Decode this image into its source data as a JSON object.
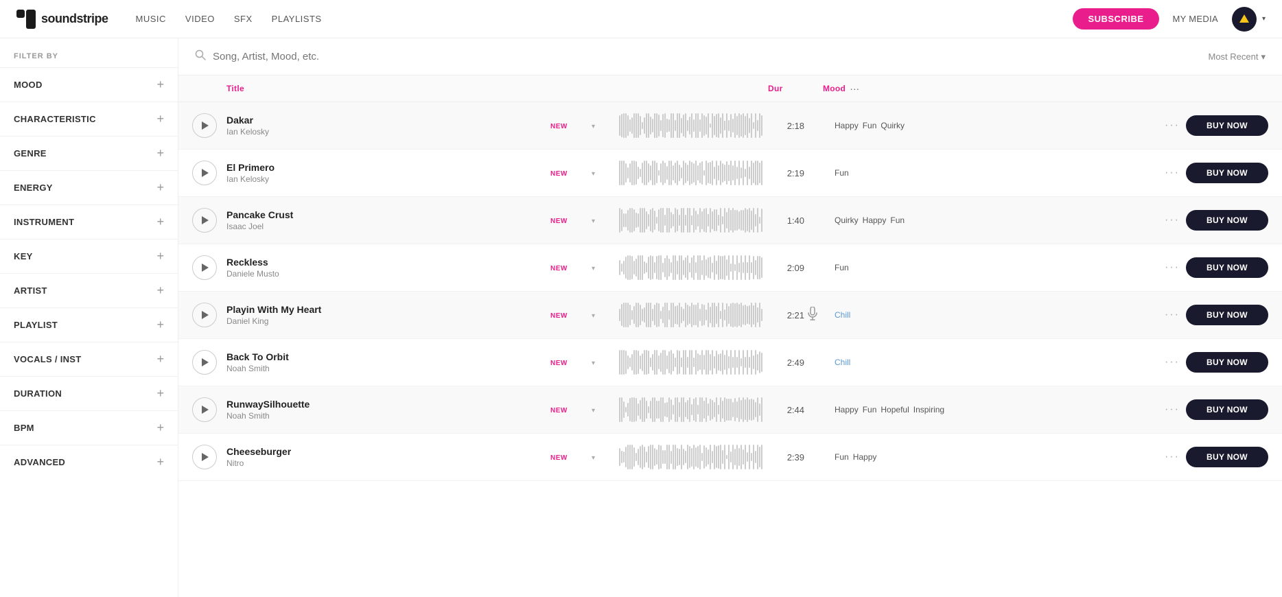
{
  "header": {
    "logo_text": "soundstripe",
    "nav": [
      {
        "label": "MUSIC",
        "id": "music"
      },
      {
        "label": "VIDEO",
        "id": "video"
      },
      {
        "label": "SFX",
        "id": "sfx"
      },
      {
        "label": "PLAYLISTS",
        "id": "playlists"
      }
    ],
    "subscribe_label": "SUBSCRIBE",
    "my_media_label": "MY MEDIA",
    "sort_label": "Most Recent",
    "sort_chevron": "▾"
  },
  "sidebar": {
    "filter_by_label": "FILTER BY",
    "filters": [
      {
        "label": "MOOD",
        "id": "mood"
      },
      {
        "label": "CHARACTERISTIC",
        "id": "characteristic"
      },
      {
        "label": "GENRE",
        "id": "genre"
      },
      {
        "label": "ENERGY",
        "id": "energy"
      },
      {
        "label": "INSTRUMENT",
        "id": "instrument"
      },
      {
        "label": "KEY",
        "id": "key"
      },
      {
        "label": "ARTIST",
        "id": "artist"
      },
      {
        "label": "PLAYLIST",
        "id": "playlist"
      },
      {
        "label": "VOCALS / INST",
        "id": "vocals"
      },
      {
        "label": "DURATION",
        "id": "duration"
      },
      {
        "label": "BPM",
        "id": "bpm"
      },
      {
        "label": "ADVANCED",
        "id": "advanced"
      }
    ]
  },
  "search": {
    "placeholder": "Song, Artist, Mood, etc."
  },
  "table": {
    "col_title": "Title",
    "col_dur": "Dur",
    "col_mood": "Mood",
    "mood_dots": "···"
  },
  "tracks": [
    {
      "title": "Dakar",
      "artist": "Ian Kelosky",
      "is_new": "NEW",
      "duration": "2:18",
      "moods": [
        "Happy",
        "Fun",
        "Quirky"
      ],
      "has_mic": false,
      "mood_colors": [
        "default",
        "default",
        "default"
      ]
    },
    {
      "title": "El Primero",
      "artist": "Ian Kelosky",
      "is_new": "NEW",
      "duration": "2:19",
      "moods": [
        "Fun"
      ],
      "has_mic": false,
      "mood_colors": [
        "default"
      ]
    },
    {
      "title": "Pancake Crust",
      "artist": "Isaac Joel",
      "is_new": "NEW",
      "duration": "1:40",
      "moods": [
        "Quirky",
        "Happy",
        "Fun"
      ],
      "has_mic": false,
      "mood_colors": [
        "default",
        "default",
        "default"
      ]
    },
    {
      "title": "Reckless",
      "artist": "Daniele Musto",
      "is_new": "NEW",
      "duration": "2:09",
      "moods": [
        "Fun"
      ],
      "has_mic": false,
      "mood_colors": [
        "default"
      ]
    },
    {
      "title": "Playin With My Heart",
      "artist": "Daniel King",
      "is_new": "NEW",
      "duration": "2:21",
      "moods": [
        "Chill"
      ],
      "has_mic": true,
      "mood_colors": [
        "chill"
      ]
    },
    {
      "title": "Back To Orbit",
      "artist": "Noah Smith",
      "is_new": "NEW",
      "duration": "2:49",
      "moods": [
        "Chill"
      ],
      "has_mic": false,
      "mood_colors": [
        "chill"
      ]
    },
    {
      "title": "RunwaySilhouette",
      "artist": "Noah Smith",
      "is_new": "NEW",
      "duration": "2:44",
      "moods": [
        "Happy",
        "Fun",
        "Hopeful",
        "Inspiring"
      ],
      "has_mic": false,
      "mood_colors": [
        "default",
        "default",
        "default",
        "default"
      ]
    },
    {
      "title": "Cheeseburger",
      "artist": "Nitro",
      "is_new": "NEW",
      "duration": "2:39",
      "moods": [
        "Fun",
        "Happy"
      ],
      "has_mic": false,
      "mood_colors": [
        "default",
        "default"
      ]
    }
  ],
  "buttons": {
    "buy_now": "BUY NOW"
  }
}
